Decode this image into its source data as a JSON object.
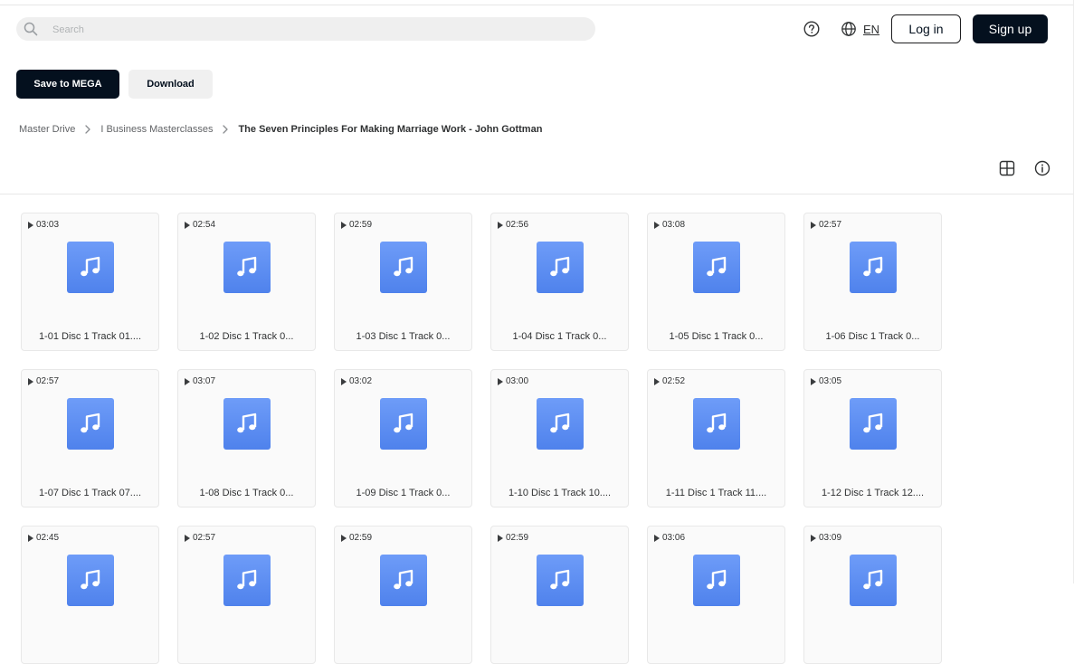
{
  "search": {
    "placeholder": "Search"
  },
  "header": {
    "language": "EN",
    "login_label": "Log in",
    "signup_label": "Sign up"
  },
  "actions": {
    "save_label": "Save to MEGA",
    "download_label": "Download"
  },
  "breadcrumb": [
    {
      "label": "Master Drive"
    },
    {
      "label": "I Business Masterclasses"
    },
    {
      "label": "The Seven Principles For Making Marriage Work - John Gottman"
    }
  ],
  "icons": {
    "search": "search-icon",
    "help": "help-circle-icon",
    "language": "globe-icon",
    "grid_view": "grid-view-icon",
    "info": "info-icon",
    "file": "music-note-icon",
    "play": "play-icon"
  },
  "colors": {
    "primary": "#04101e",
    "file_icon_top": "#6e9cf8",
    "file_icon_bottom": "#4f82ec"
  },
  "files": [
    {
      "duration": "03:03",
      "name": "1-01 Disc 1 Track 01...."
    },
    {
      "duration": "02:54",
      "name": "1-02 Disc 1 Track 0..."
    },
    {
      "duration": "02:59",
      "name": "1-03 Disc 1 Track 0..."
    },
    {
      "duration": "02:56",
      "name": "1-04 Disc 1 Track 0..."
    },
    {
      "duration": "03:08",
      "name": "1-05 Disc 1 Track 0..."
    },
    {
      "duration": "02:57",
      "name": "1-06 Disc 1 Track 0..."
    },
    {
      "duration": "02:57",
      "name": "1-07 Disc 1 Track 07...."
    },
    {
      "duration": "03:07",
      "name": "1-08 Disc 1 Track 0..."
    },
    {
      "duration": "03:02",
      "name": "1-09 Disc 1 Track 0..."
    },
    {
      "duration": "03:00",
      "name": "1-10 Disc 1 Track 10...."
    },
    {
      "duration": "02:52",
      "name": "1-11 Disc 1 Track 11...."
    },
    {
      "duration": "03:05",
      "name": "1-12 Disc 1 Track 12...."
    },
    {
      "duration": "02:45",
      "name": ""
    },
    {
      "duration": "02:57",
      "name": ""
    },
    {
      "duration": "02:59",
      "name": ""
    },
    {
      "duration": "02:59",
      "name": ""
    },
    {
      "duration": "03:06",
      "name": ""
    },
    {
      "duration": "03:09",
      "name": ""
    }
  ]
}
